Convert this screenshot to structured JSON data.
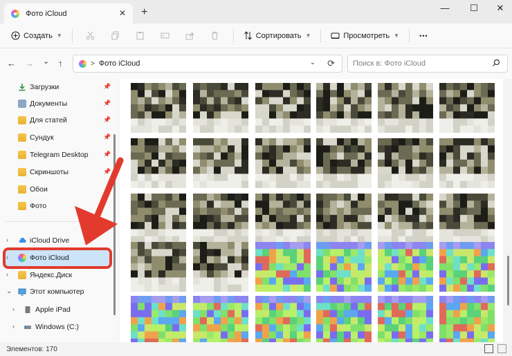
{
  "window": {
    "tab_title": "Фото iCloud",
    "tab_close": "✕",
    "new_tab": "+",
    "minimize": "—",
    "maximize": "☐",
    "close": "✕"
  },
  "toolbar": {
    "create_label": "Создать",
    "sort_label": "Сортировать",
    "view_label": "Просмотреть",
    "more_label": "•••"
  },
  "nav": {
    "back": "←",
    "forward": "→",
    "recent": "⌄",
    "up": "↑"
  },
  "address": {
    "path": "Фото iCloud",
    "separator": ">",
    "dropdown": "⌄",
    "refresh": "⟳"
  },
  "search": {
    "placeholder": "Поиск в: Фото iCloud",
    "icon": "⌕"
  },
  "sidebar": {
    "quick_access": [
      {
        "label": "Загрузки",
        "icon": "download-icon",
        "pinned": true
      },
      {
        "label": "Документы",
        "icon": "documents-icon",
        "pinned": true
      },
      {
        "label": "Для статей",
        "icon": "folder-icon",
        "pinned": true
      },
      {
        "label": "Сундук",
        "icon": "folder-icon",
        "pinned": true
      },
      {
        "label": "Telegram Desktop",
        "icon": "folder-icon",
        "pinned": true
      },
      {
        "label": "Скриншоты",
        "icon": "folder-icon",
        "pinned": true
      },
      {
        "label": "Обои",
        "icon": "folder-icon",
        "pinned": false
      },
      {
        "label": "Фото",
        "icon": "folder-icon",
        "pinned": false
      }
    ],
    "locations": [
      {
        "label": "iCloud Drive",
        "icon": "icloud-icon"
      },
      {
        "label": "Фото iCloud",
        "icon": "icloud-photos-icon",
        "selected": true
      },
      {
        "label": "Яндекс.Диск",
        "icon": "yandex-disk-icon"
      },
      {
        "label": "Этот компьютер",
        "icon": "computer-icon",
        "expanded": true
      },
      {
        "label": "Apple iPad",
        "icon": "ipad-icon"
      },
      {
        "label": "Windows (C:)",
        "icon": "drive-icon"
      }
    ]
  },
  "status": {
    "items_count": "Элементов: 170"
  },
  "colors": {
    "accent_red": "#e23b2e",
    "selection": "#cce4f7"
  }
}
